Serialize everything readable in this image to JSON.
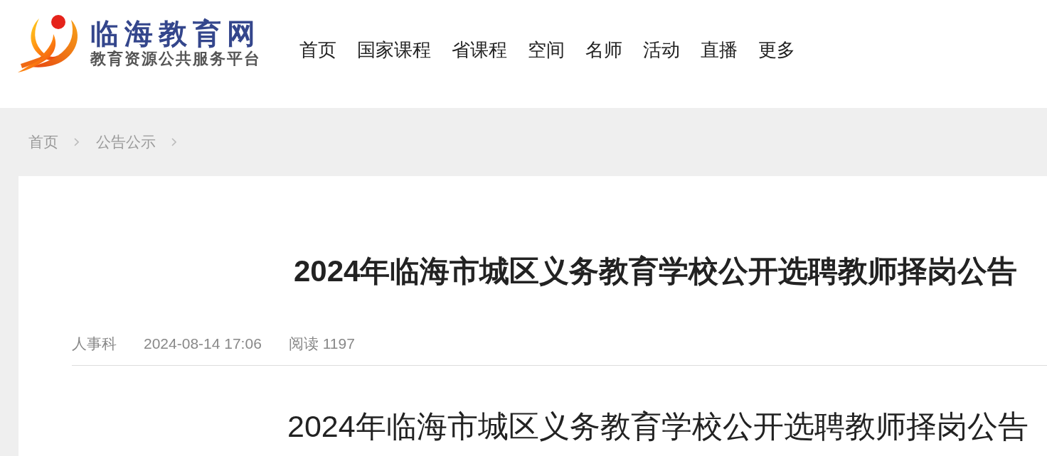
{
  "logo": {
    "title": "临海教育网",
    "subtitle": "教育资源公共服务平台"
  },
  "nav": [
    "首页",
    "国家课程",
    "省课程",
    "空间",
    "名师",
    "活动",
    "直播",
    "更多"
  ],
  "breadcrumb": [
    "首页",
    "公告公示"
  ],
  "article": {
    "title": "2024年临海市城区义务教育学校公开选聘教师择岗公告",
    "meta": [
      "人事科",
      "2024-08-14 17:06",
      "阅读 1197"
    ],
    "body_heading": "2024年临海市城区义务教育学校公开选聘教师择岗公告"
  }
}
